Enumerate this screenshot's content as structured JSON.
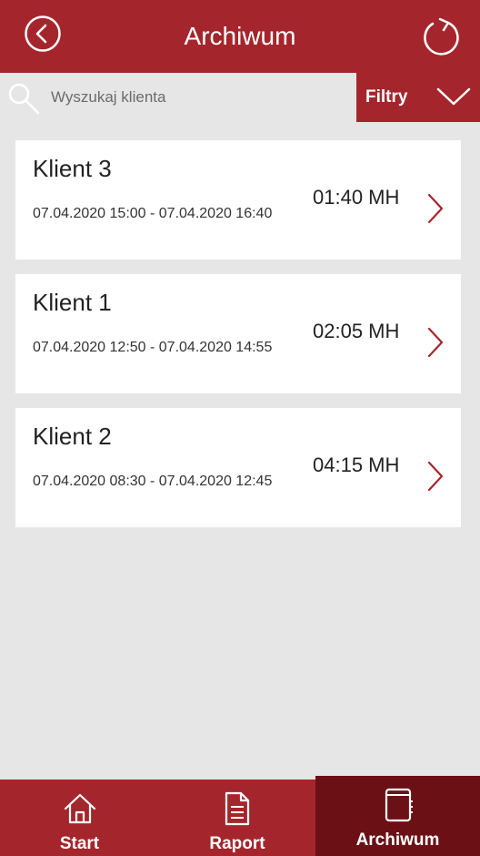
{
  "header": {
    "title": "Archiwum",
    "back_icon": "back-circle-icon",
    "refresh_icon": "refresh-icon"
  },
  "search": {
    "placeholder": "Wyszukaj klienta",
    "value": ""
  },
  "filter": {
    "label": "Filtry"
  },
  "records": [
    {
      "name": "Klient 3",
      "range": "07.04.2020 15:00 - 07.04.2020 16:40",
      "duration": "01:40 MH"
    },
    {
      "name": "Klient 1",
      "range": "07.04.2020 12:50 - 07.04.2020 14:55",
      "duration": "02:05 MH"
    },
    {
      "name": "Klient 2",
      "range": "07.04.2020 08:30 - 07.04.2020 12:45",
      "duration": "04:15 MH"
    }
  ],
  "nav": {
    "items": [
      {
        "label": "Start",
        "icon": "home-icon",
        "active": false
      },
      {
        "label": "Raport",
        "icon": "document-icon",
        "active": false
      },
      {
        "label": "Archiwum",
        "icon": "notebook-icon",
        "active": true
      }
    ]
  },
  "colors": {
    "brand": "#a4262c",
    "brand_dark": "#6b1115",
    "background": "#e6e6e6",
    "card": "#ffffff"
  }
}
